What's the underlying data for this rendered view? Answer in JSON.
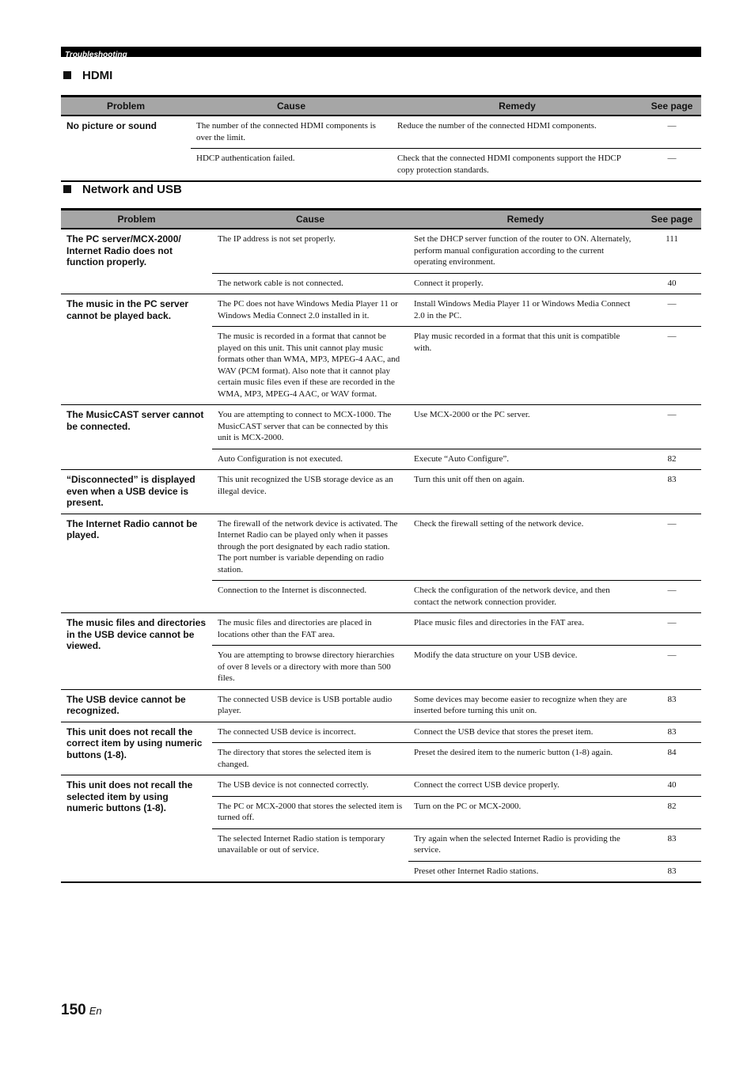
{
  "header": {
    "section_label": "Troubleshooting"
  },
  "hdmi": {
    "title": "HDMI",
    "columns": [
      "Problem",
      "Cause",
      "Remedy",
      "See page"
    ],
    "groups": [
      {
        "problem": "No picture or sound",
        "rows": [
          {
            "cause": "The number of the connected HDMI components is over the limit.",
            "remedy": "Reduce the number of the connected HDMI components.",
            "page": "—"
          },
          {
            "cause": "HDCP authentication failed.",
            "remedy": "Check that the connected HDMI components support the HDCP copy protection standards.",
            "page": "—"
          }
        ]
      }
    ]
  },
  "network": {
    "title": "Network and USB",
    "columns": [
      "Problem",
      "Cause",
      "Remedy",
      "See page"
    ],
    "groups": [
      {
        "problem": "The PC server/MCX-2000/ Internet Radio does not function properly.",
        "rows": [
          {
            "cause": "The IP address is not set properly.",
            "remedy": "Set the DHCP server function of the router to ON. Alternately, perform manual configuration according to the current operating environment.",
            "page": "111"
          },
          {
            "cause": "The network cable is not connected.",
            "remedy": "Connect it properly.",
            "page": "40"
          }
        ]
      },
      {
        "problem": "The music in the PC server cannot be played back.",
        "rows": [
          {
            "cause": "The PC does not have Windows Media Player 11 or Windows Media Connect 2.0 installed in it.",
            "remedy": "Install Windows Media Player 11 or Windows Media Connect 2.0 in the PC.",
            "page": "—"
          },
          {
            "cause": "The music is recorded in a format that cannot be played on this unit. This unit cannot play music formats other than WMA, MP3, MPEG-4 AAC, and WAV (PCM format). Also note that it cannot play certain music files even if these are recorded in the WMA, MP3, MPEG-4 AAC, or WAV format.",
            "remedy": "Play music recorded in a format that this unit is compatible with.",
            "page": "—"
          }
        ]
      },
      {
        "problem": "The MusicCAST server cannot be connected.",
        "rows": [
          {
            "cause": "You are attempting to connect to MCX-1000. The MusicCAST server that can be connected by this unit is MCX-2000.",
            "remedy": "Use MCX-2000 or the PC server.",
            "page": "—"
          },
          {
            "cause": "Auto Configuration is not executed.",
            "remedy": "Execute “Auto Configure”.",
            "page": "82"
          }
        ]
      },
      {
        "problem": "“Disconnected” is displayed even when a USB device is present.",
        "rows": [
          {
            "cause": "This unit recognized the USB storage device as an illegal device.",
            "remedy": "Turn this unit off then on again.",
            "page": "83"
          }
        ]
      },
      {
        "problem": "The Internet Radio cannot be played.",
        "rows": [
          {
            "cause": "The firewall of the network device is activated. The Internet Radio can be played only when it passes through the port designated by each radio station. The port number is variable depending on radio station.",
            "remedy": "Check the firewall setting of the network device.",
            "page": "—"
          },
          {
            "cause": "Connection to the Internet is disconnected.",
            "remedy": "Check the configuration of the network device, and then contact the network connection provider.",
            "page": "—"
          }
        ]
      },
      {
        "problem": "The music files and directories in the USB device cannot be viewed.",
        "rows": [
          {
            "cause": "The music files and directories are placed in locations other than the FAT area.",
            "remedy": "Place music files and directories in the FAT area.",
            "page": "—"
          },
          {
            "cause": "You are attempting to browse directory hierarchies of over 8 levels or a directory with more than 500 files.",
            "remedy": "Modify the data structure on your USB device.",
            "page": "—"
          }
        ]
      },
      {
        "problem": "The USB device cannot be recognized.",
        "rows": [
          {
            "cause": "The connected USB device is USB portable audio player.",
            "remedy": "Some devices may become easier to recognize when they are inserted before turning this unit on.",
            "page": "83"
          }
        ]
      },
      {
        "problem": "This unit does not recall the correct item by using numeric buttons (1-8).",
        "rows": [
          {
            "cause": "The connected USB device is incorrect.",
            "remedy": "Connect the USB device that stores the preset item.",
            "page": "83"
          },
          {
            "cause": "The directory that stores the selected item is changed.",
            "remedy": "Preset the desired item to the numeric button (1-8) again.",
            "page": "84"
          }
        ]
      },
      {
        "problem": "This unit does not recall the selected item by using numeric buttons (1-8).",
        "rows": [
          {
            "cause": "The USB device is not connected correctly.",
            "remedy": "Connect the correct USB device properly.",
            "page": "40"
          },
          {
            "cause": "The PC or MCX-2000 that stores the selected item is turned off.",
            "remedy": "Turn on the PC or MCX-2000.",
            "page": "82"
          },
          {
            "cause": "The selected Internet Radio station is temporary unavailable or out of service.",
            "cause_rows": 2,
            "remedy": "Try again when the selected Internet Radio is providing the service.",
            "page": "83"
          },
          {
            "cause": null,
            "remedy": "Preset other Internet Radio stations.",
            "page": "83"
          }
        ]
      }
    ]
  },
  "footer": {
    "page_number": "150",
    "language": "En"
  }
}
